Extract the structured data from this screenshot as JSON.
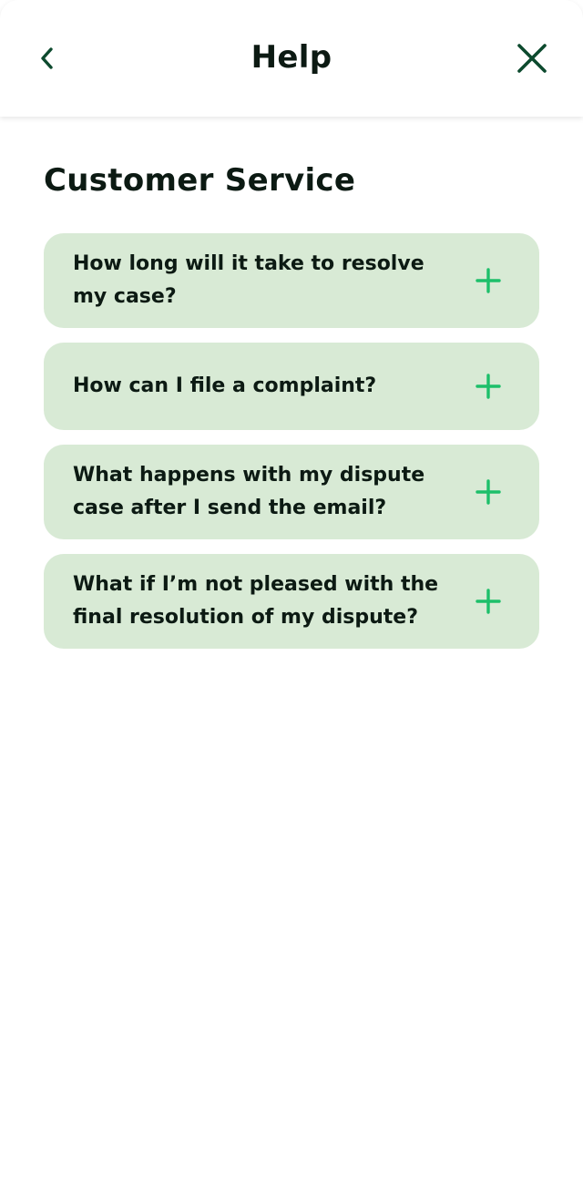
{
  "header": {
    "title": "Help",
    "back_icon": "chevron-left-icon",
    "close_icon": "close-icon"
  },
  "section": {
    "title": "Customer Service"
  },
  "faq": {
    "items": [
      {
        "question": "How long will it take to resolve my case?"
      },
      {
        "question": "How can I file a complaint?"
      },
      {
        "question": "What happens with my dispute case after I send the email?"
      },
      {
        "question": "What if I’m not pleased with the final resolution of my dispute?"
      }
    ],
    "toggle_icon": "plus-icon"
  },
  "colors": {
    "accent": "#1dbf6a",
    "dark_green": "#0d4a2e",
    "card_background": "#d8ead5",
    "text": "#0c1a13"
  }
}
